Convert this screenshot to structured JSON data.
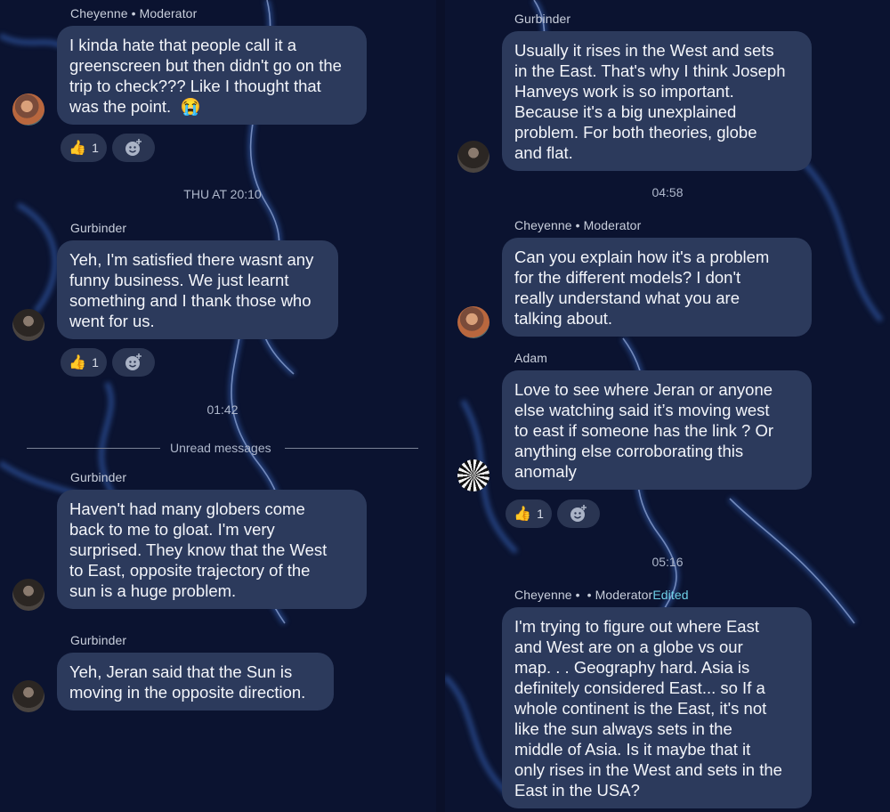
{
  "left": {
    "messages": [
      {
        "sender": "Cheyenne",
        "role": "Moderator",
        "lines": [
          "I kinda hate that people call it a",
          "greenscreen but then didn't go on the",
          "trip to check??? Like I thought that",
          "was the point."
        ],
        "emoji": "😭",
        "reaction_count": "1"
      },
      {
        "sender": "Gurbinder",
        "lines": [
          "Yeh, I'm satisfied there wasnt any",
          "funny business. We just learnt",
          "something and I thank those who",
          "went for us."
        ],
        "reaction_count": "1"
      },
      {
        "sender": "Gurbinder",
        "lines": [
          "Haven't had many globers come",
          "back to me to gloat. I'm very",
          "surprised. They know that the West",
          "to East, opposite trajectory of the",
          "sun is a huge problem."
        ]
      },
      {
        "sender": "Gurbinder",
        "lines": [
          "Yeh, Jeran said that the Sun is",
          "moving in the opposite direction."
        ]
      }
    ],
    "ts1": "THU AT 20:10",
    "ts2": "01:42",
    "unread_label": "Unread messages"
  },
  "right": {
    "messages": [
      {
        "sender": "Gurbinder",
        "lines": [
          "Usually it rises in the West and sets",
          "in the East. That's why I think Joseph",
          "Hanveys work is so important.",
          "Because it's a big unexplained",
          "problem. For both theories, globe",
          "and flat."
        ]
      },
      {
        "sender": "Cheyenne",
        "role": "Moderator",
        "lines": [
          "Can you explain how it's a problem",
          "for the different models? I don't",
          "really understand what you are",
          "talking about."
        ]
      },
      {
        "sender": "Adam",
        "lines": [
          "Love to see where Jeran or anyone",
          "else watching said it’s moving west",
          "to east if someone has the link ?  Or",
          "anything else corroborating this",
          "anomaly"
        ],
        "reaction_count": "1"
      },
      {
        "sender": "Cheyenne",
        "role": "Moderator",
        "edited": "Edited",
        "lines": [
          "I'm trying to figure out where East",
          "and West are on a globe vs our",
          "map. . . Geography hard. Asia is",
          "definitely considered East... so If a",
          "whole continent is the East, it's not",
          "like the sun always sets in the",
          "middle of Asia. Is it maybe that it",
          "only rises in the West and sets in the",
          "East in the USA?"
        ]
      }
    ],
    "ts1": "04:58",
    "ts2": "05:16"
  },
  "icons": {
    "reaction_emoji": "👍",
    "add_reaction": "add-reaction-icon"
  },
  "colors": {
    "bubble": "#2c3a5c",
    "background": "#0b1330",
    "edited": "#6fd0e6"
  }
}
